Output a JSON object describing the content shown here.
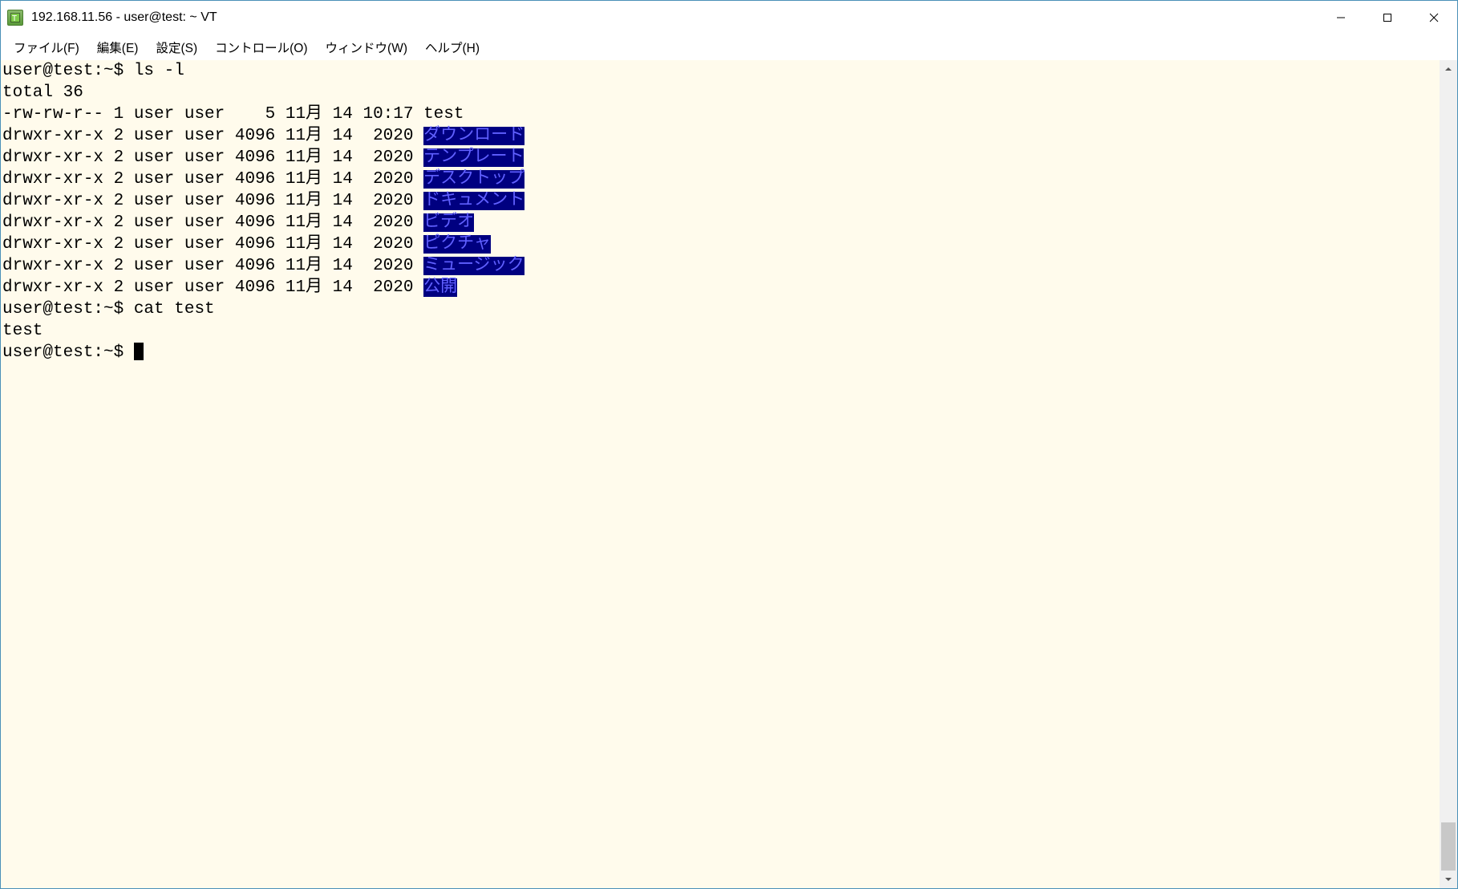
{
  "window": {
    "title": "192.168.11.56 - user@test: ~ VT"
  },
  "menu": {
    "file": "ファイル(F)",
    "edit": "編集(E)",
    "settings": "設定(S)",
    "control": "コントロール(O)",
    "window": "ウィンドウ(W)",
    "help": "ヘルプ(H)"
  },
  "terminal": {
    "prompt1": "user@test:~$ ls -l",
    "total": "total 36",
    "rows": [
      {
        "meta": "-rw-rw-r-- 1 user user    5 11月 14 10:17 ",
        "name": "test",
        "dir": false
      },
      {
        "meta": "drwxr-xr-x 2 user user 4096 11月 14  2020 ",
        "name": "ダウンロード",
        "dir": true
      },
      {
        "meta": "drwxr-xr-x 2 user user 4096 11月 14  2020 ",
        "name": "テンプレート",
        "dir": true
      },
      {
        "meta": "drwxr-xr-x 2 user user 4096 11月 14  2020 ",
        "name": "デスクトップ",
        "dir": true
      },
      {
        "meta": "drwxr-xr-x 2 user user 4096 11月 14  2020 ",
        "name": "ドキュメント",
        "dir": true
      },
      {
        "meta": "drwxr-xr-x 2 user user 4096 11月 14  2020 ",
        "name": "ビデオ",
        "dir": true
      },
      {
        "meta": "drwxr-xr-x 2 user user 4096 11月 14  2020 ",
        "name": "ピクチャ",
        "dir": true
      },
      {
        "meta": "drwxr-xr-x 2 user user 4096 11月 14  2020 ",
        "name": "ミュージック",
        "dir": true
      },
      {
        "meta": "drwxr-xr-x 2 user user 4096 11月 14  2020 ",
        "name": "公開",
        "dir": true
      }
    ],
    "prompt2": "user@test:~$ cat test",
    "output2": "test",
    "prompt3": "user@test:~$ "
  }
}
